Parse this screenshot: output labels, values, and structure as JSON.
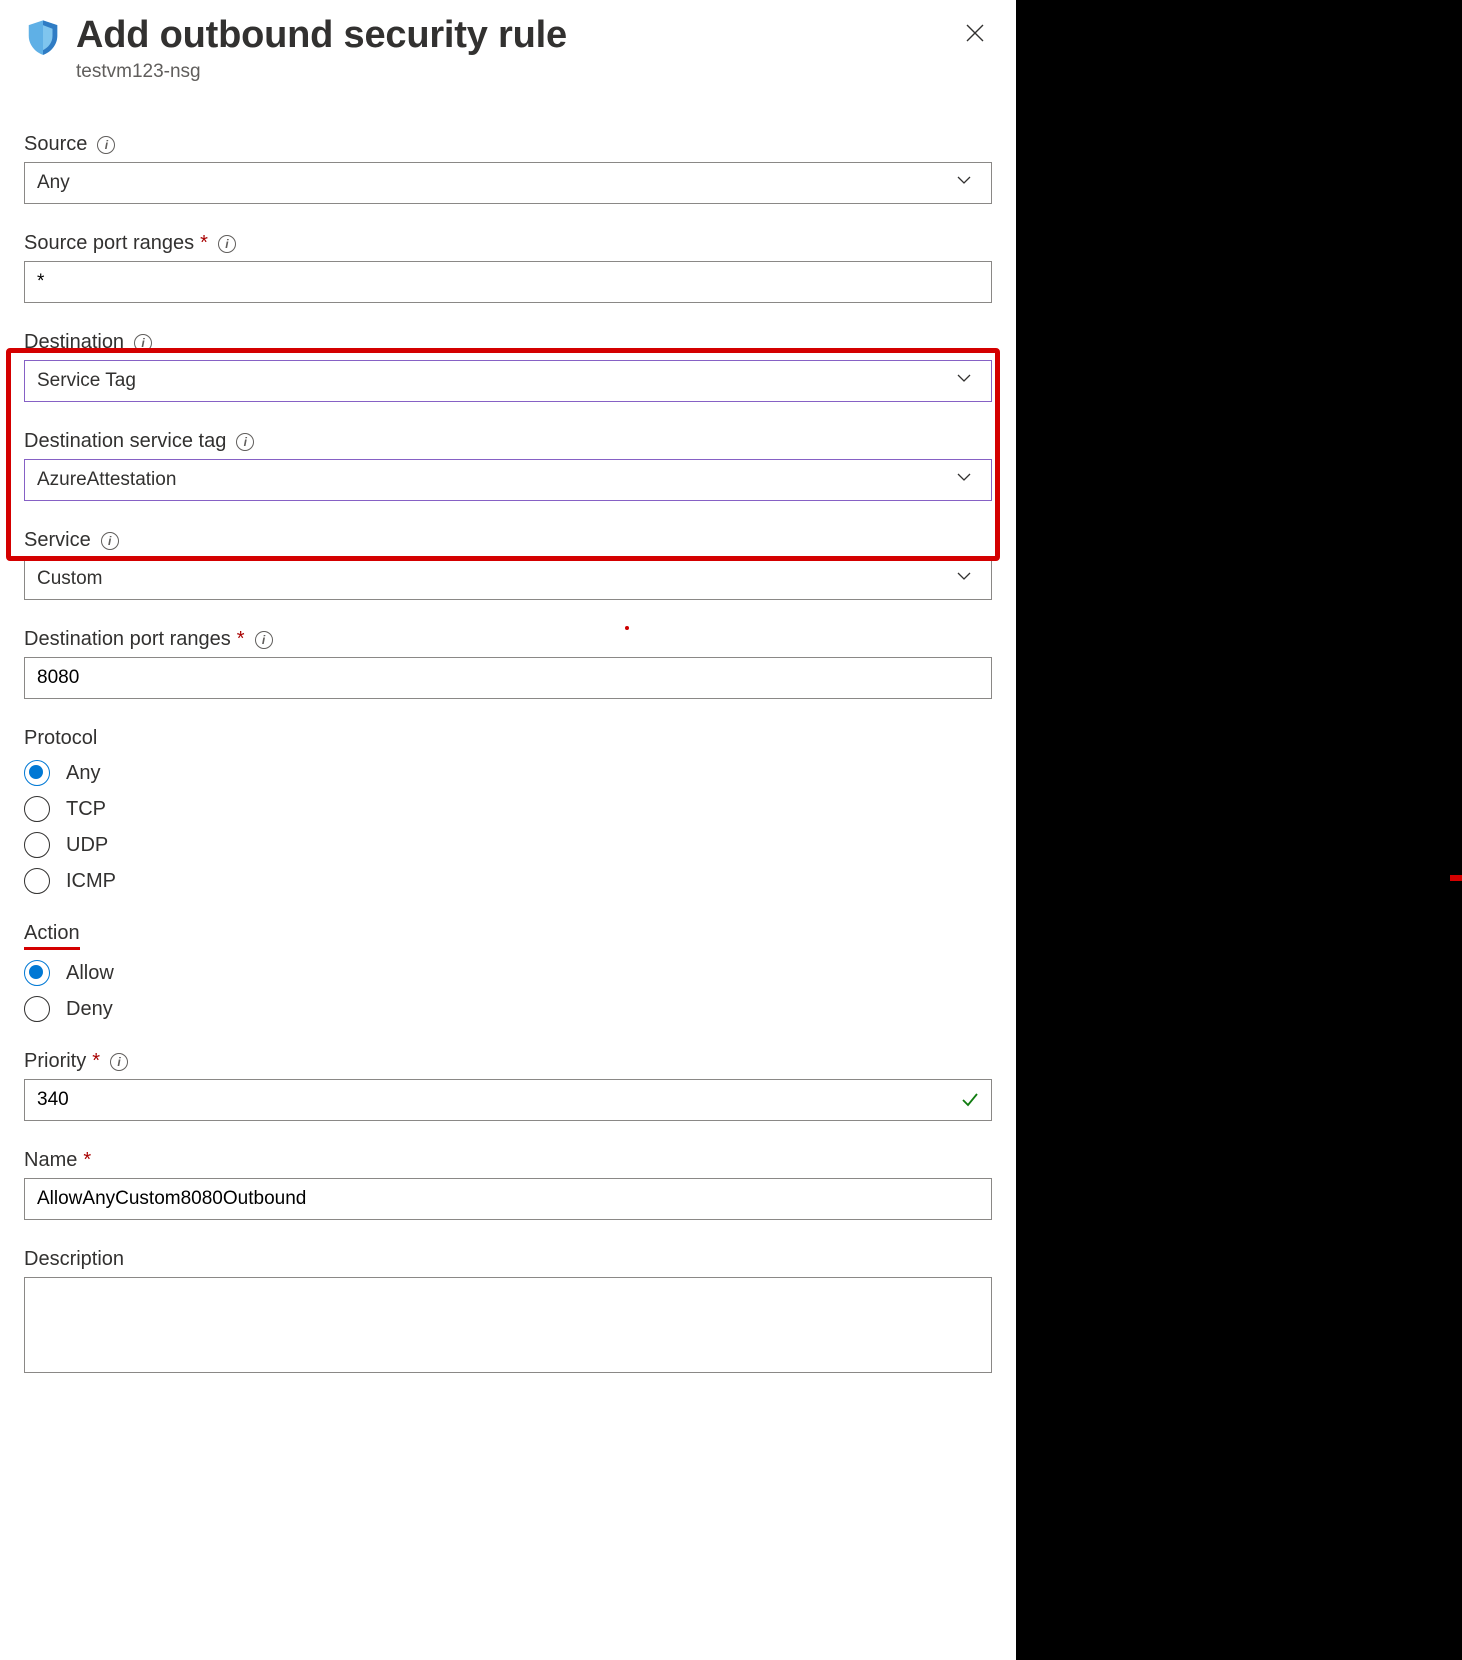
{
  "header": {
    "title": "Add outbound security rule",
    "subtitle": "testvm123-nsg"
  },
  "labels": {
    "source": "Source",
    "source_port_ranges": "Source port ranges",
    "destination": "Destination",
    "destination_service_tag": "Destination service tag",
    "service": "Service",
    "destination_port_ranges": "Destination port ranges",
    "protocol": "Protocol",
    "action": "Action",
    "priority": "Priority",
    "name": "Name",
    "description": "Description"
  },
  "values": {
    "source": "Any",
    "source_port_ranges": "*",
    "destination": "Service Tag",
    "destination_service_tag": "AzureAttestation",
    "service": "Custom",
    "destination_port_ranges": "8080",
    "priority": "340",
    "name": "AllowAnyCustom8080Outbound",
    "description": ""
  },
  "protocol_options": [
    "Any",
    "TCP",
    "UDP",
    "ICMP"
  ],
  "protocol_selected": "Any",
  "action_options": [
    "Allow",
    "Deny"
  ],
  "action_selected": "Allow"
}
